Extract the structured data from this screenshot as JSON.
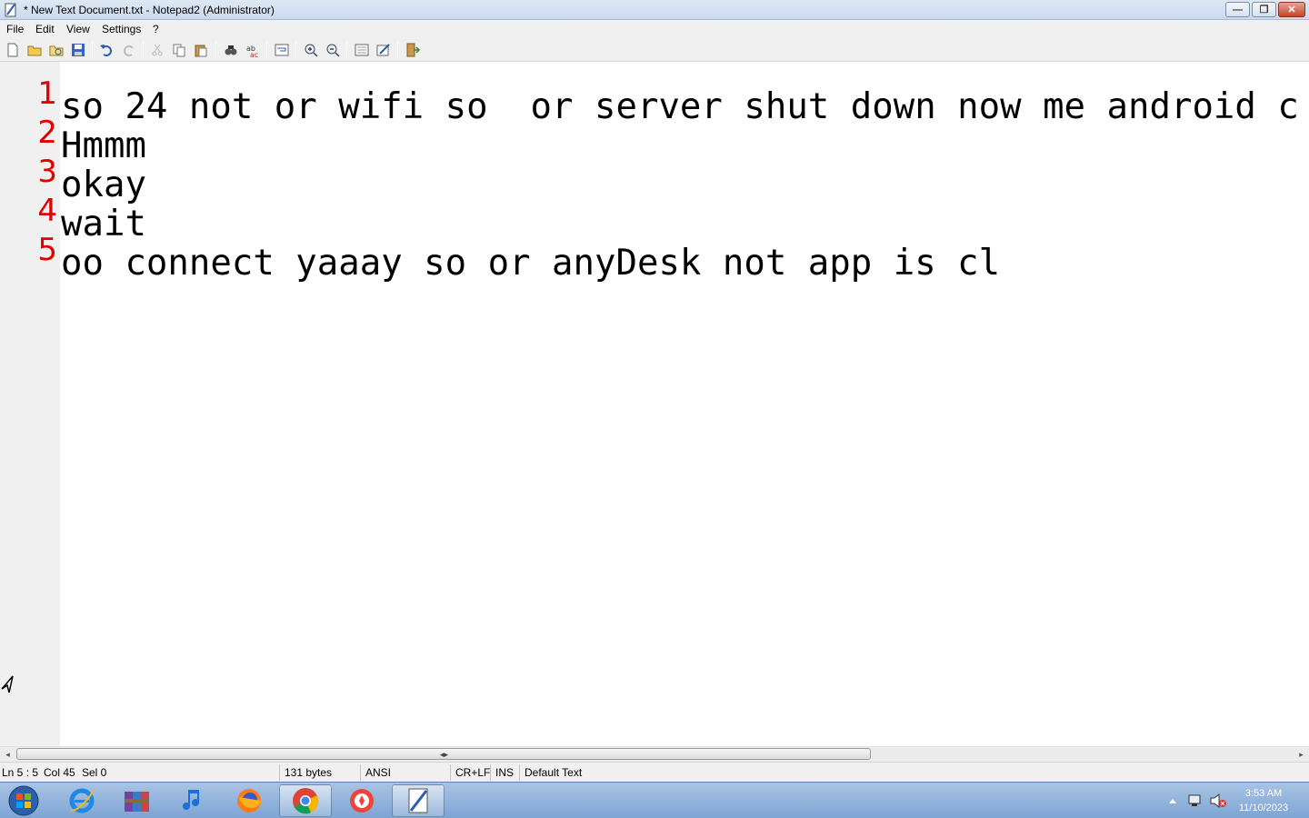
{
  "window": {
    "title": "* New Text Document.txt - Notepad2 (Administrator)",
    "buttons": {
      "minimize": "—",
      "restore": "❐",
      "close": "✕"
    }
  },
  "menu": [
    "File",
    "Edit",
    "View",
    "Settings",
    "?"
  ],
  "toolbar": [
    {
      "name": "new-file-icon"
    },
    {
      "name": "open-file-icon"
    },
    {
      "name": "browse-icon"
    },
    {
      "name": "save-icon"
    },
    {
      "name": "undo-icon"
    },
    {
      "name": "redo-icon"
    },
    {
      "name": "cut-icon"
    },
    {
      "name": "copy-icon"
    },
    {
      "name": "paste-icon"
    },
    {
      "name": "find-icon"
    },
    {
      "name": "replace-icon"
    },
    {
      "name": "word-wrap-icon"
    },
    {
      "name": "zoom-in-icon"
    },
    {
      "name": "zoom-out-icon"
    },
    {
      "name": "schemes-icon"
    },
    {
      "name": "customize-schemes-icon"
    },
    {
      "name": "exit-icon"
    }
  ],
  "editor": {
    "lines": [
      {
        "num": "1",
        "text": "so 24 not or wifi so  or server shut down now me android c"
      },
      {
        "num": "2",
        "text": "Hmmm"
      },
      {
        "num": "3",
        "text": "okay"
      },
      {
        "num": "4",
        "text": "wait"
      },
      {
        "num": "5",
        "text": "oo connect yaaay so or anyDesk not app is cl"
      }
    ]
  },
  "scrollbar": {
    "left_arrow": "◂",
    "right_arrow": "▸",
    "grip": "◂▸"
  },
  "status": {
    "position": "Ln 5 : 5",
    "column": "Col 45",
    "selection": "Sel 0",
    "size": "131 bytes",
    "encoding": "ANSI",
    "line_endings": "CR+LF",
    "insert_mode": "INS",
    "scheme": "Default Text"
  },
  "taskbar": {
    "apps": [
      "internet-explorer",
      "file-archiver",
      "itunes",
      "firefox",
      "chrome",
      "anydesk",
      "notepad2"
    ],
    "active_app": "notepad2",
    "clock_time": "3:53 AM",
    "clock_date": "11/10/2023"
  },
  "colors": {
    "line_number": "#e00000",
    "gutter": "#f0f0f0",
    "taskbar": "#8fb1da"
  }
}
